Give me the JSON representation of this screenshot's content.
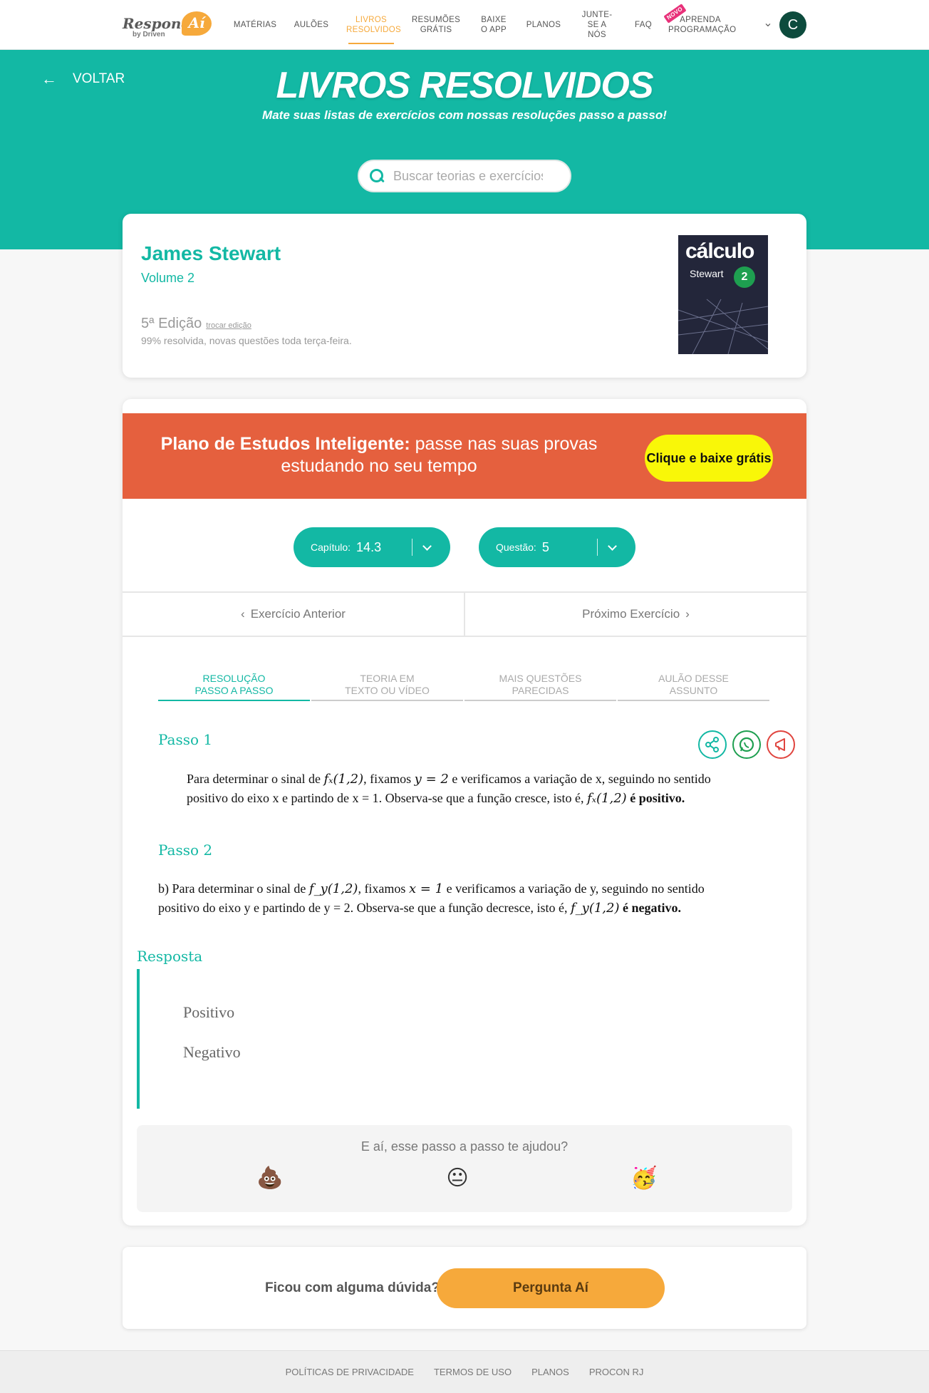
{
  "brand": {
    "logo_word": "Responde",
    "logo_bubble": "Aí",
    "logo_sub": "by Driven",
    "accent": "#13b8a4",
    "orange": "#f6a93b",
    "promo": "#e5603e"
  },
  "nav": {
    "items": [
      {
        "label": "MATÉRIAS"
      },
      {
        "label": "AULÕES"
      },
      {
        "label": "LIVROS RESOLVIDOS"
      },
      {
        "label": "RESUMÕES GRÁTIS"
      },
      {
        "label": "BAIXE O APP"
      },
      {
        "label": "PLANOS"
      },
      {
        "label": "JUNTE-SE A NÓS"
      },
      {
        "label": "FAQ"
      },
      {
        "label": "APRENDA PROGRAMAÇÃO",
        "badge": "NOVO"
      }
    ],
    "active_index": 2,
    "avatar_letter": "C"
  },
  "hero": {
    "back_label": "VOLTAR",
    "title": "LIVROS RESOLVIDOS",
    "subtitle": "Mate suas listas de exercícios com nossas resoluções passo a passo!",
    "search_placeholder": "Buscar teorias e exercícios"
  },
  "book": {
    "author": "James Stewart",
    "volume": "Volume 2",
    "edition": "5ª Edição",
    "swap_edition": "trocar edição",
    "status": "99% resolvida, novas questões toda terça-feira.",
    "cover_title": "cálculo",
    "cover_author": "Stewart",
    "cover_volume": "2"
  },
  "promo": {
    "bold": "Plano de Estudos Inteligente:",
    "text": " passe nas suas provas estudando no seu tempo",
    "button": "Clique e baixe grátis"
  },
  "selectors": {
    "chapter_label": "Capítulo:",
    "chapter_value": "14.3",
    "question_label": "Questão:",
    "question_value": "5"
  },
  "exercise_nav": {
    "prev": "Exercício Anterior",
    "next": "Próximo Exercício"
  },
  "tabs": [
    {
      "line1": "RESOLUÇÃO",
      "line2": "PASSO A PASSO"
    },
    {
      "line1": "TEORIA EM",
      "line2": "TEXTO OU VÍDEO"
    },
    {
      "line1": "MAIS QUESTÕES",
      "line2": "PARECIDAS"
    },
    {
      "line1": "AULÃO DESSE",
      "line2": "ASSUNTO"
    }
  ],
  "steps": {
    "step1_title": "Passo 1",
    "step1_text_a": "Para determinar o sinal de ",
    "step1_math_a": "fₓ(1,2)",
    "step1_text_b": ", fixamos ",
    "step1_math_b": "y = 2",
    "step1_text_c": " e verificamos a variação de x, seguindo no sentido positivo do eixo x e partindo de x = 1. Observa-se que a função cresce, isto é, ",
    "step1_math_c": "fₓ(1,2)",
    "step1_bold": " é positivo.",
    "step2_title": "Passo 2",
    "step2_text_a": "b) Para determinar o sinal de ",
    "step2_math_a": "f_y(1,2)",
    "step2_text_b": ", fixamos ",
    "step2_math_b": "x = 1",
    "step2_text_c": " e verificamos a variação de y, seguindo no sentido positivo do eixo y e partindo de y = 2. Observa-se que a função decresce, isto é, ",
    "step2_math_c": "f_y(1,2)",
    "step2_bold": " é negativo."
  },
  "answer": {
    "title": "Resposta",
    "items": [
      "Positivo",
      "Negativo"
    ]
  },
  "feedback": {
    "question": "E aí, esse passo a passo te ajudou?",
    "emojis": [
      "💩",
      "😐",
      "🥳"
    ]
  },
  "help": {
    "question": "Ficou com alguma dúvida?",
    "button": "Pergunta Aí"
  },
  "footer": {
    "links": [
      "POLÍTICAS DE PRIVACIDADE",
      "TERMOS DE USO",
      "PLANOS",
      "PROCON RJ"
    ]
  }
}
